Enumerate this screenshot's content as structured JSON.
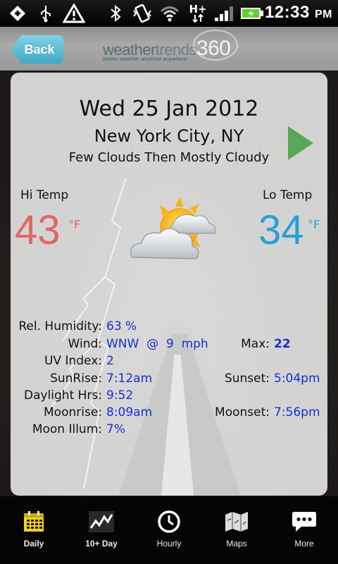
{
  "status_bar": {
    "time": "12:33",
    "ampm": "PM",
    "icons": [
      "usb-debug-icon",
      "usb-icon",
      "warning-icon",
      "bluetooth-icon",
      "vibrate-icon",
      "wifi-icon",
      "hplus-data-icon",
      "signal-icon",
      "battery-charging-icon"
    ],
    "network_label": "H+"
  },
  "header": {
    "back_label": "Back",
    "logo_weather": "weather",
    "logo_trends": "trends",
    "logo_360": "360",
    "logo_tagline": "better weather anytime anywhere"
  },
  "forecast": {
    "date": "Wed 25 Jan 2012",
    "city": "New York City, NY",
    "condition": "Few Clouds Then Mostly Cloudy",
    "hi_label": "Hi Temp",
    "hi_value": "43",
    "hi_unit": "°F",
    "lo_label": "Lo Temp",
    "lo_value": "34",
    "lo_unit": "°F",
    "weather_icon": "partly-cloudy-icon"
  },
  "details": {
    "humidity_label": "Rel. Humidity:",
    "humidity_value": "63 %",
    "wind_label": "Wind:",
    "wind_value": "WNW  @  9  mph",
    "max_label": "Max:",
    "max_value": "22",
    "uv_label": "UV Index:",
    "uv_value": "2",
    "sunrise_label": "SunRise:",
    "sunrise_value": "7:12am",
    "sunset_label": "Sunset:",
    "sunset_value": "5:04pm",
    "daylight_label": "Daylight Hrs:",
    "daylight_value": "9:52",
    "moonrise_label": "Moonrise:",
    "moonrise_value": "8:09am",
    "moonset_label": "Moonset:",
    "moonset_value": "7:56pm",
    "moonillum_label": "Moon Illum:",
    "moonillum_value": "7%"
  },
  "nav": {
    "tabs": [
      {
        "label": "Daily",
        "icon": "calendar-icon",
        "active": true
      },
      {
        "label": "10+ Day",
        "icon": "trend-chart-icon",
        "active": false
      },
      {
        "label": "Hourly",
        "icon": "clock-icon",
        "active": false
      },
      {
        "label": "Maps",
        "icon": "map-icon",
        "active": false
      },
      {
        "label": "More",
        "icon": "speech-bubble-icon",
        "active": false
      }
    ]
  },
  "colors": {
    "hi_temp": "#e06666",
    "lo_temp": "#2aa0d8",
    "value_text": "#1530d0",
    "back_button": "#3fa9c4",
    "next_arrow": "#5aa657",
    "calendar_active": "#f2d21e"
  }
}
